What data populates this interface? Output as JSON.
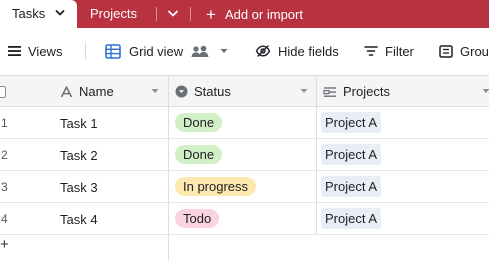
{
  "tabs": {
    "active_label": "Tasks",
    "projects_label": "Projects",
    "add_import_label": "Add or import",
    "accent_color": "#b8323f"
  },
  "toolbar": {
    "views_label": "Views",
    "grid_view_label": "Grid view",
    "hide_fields_label": "Hide fields",
    "filter_label": "Filter",
    "group_label": "Group"
  },
  "grid": {
    "columns": [
      {
        "label": "Name",
        "icon": "text-field-icon"
      },
      {
        "label": "Status",
        "icon": "single-select-icon"
      },
      {
        "label": "Projects",
        "icon": "linked-record-icon"
      }
    ],
    "rows": [
      {
        "num": "1",
        "name": "Task 1",
        "status": "Done",
        "status_color": "#d1f0c7",
        "project": "Project A"
      },
      {
        "num": "2",
        "name": "Task 2",
        "status": "Done",
        "status_color": "#d1f0c7",
        "project": "Project A"
      },
      {
        "num": "3",
        "name": "Task 3",
        "status": "In progress",
        "status_color": "#fde9b0",
        "project": "Project A"
      },
      {
        "num": "4",
        "name": "Task 4",
        "status": "Todo",
        "status_color": "#fbd3df",
        "project": "Project A"
      }
    ],
    "add_row_label": "+"
  }
}
